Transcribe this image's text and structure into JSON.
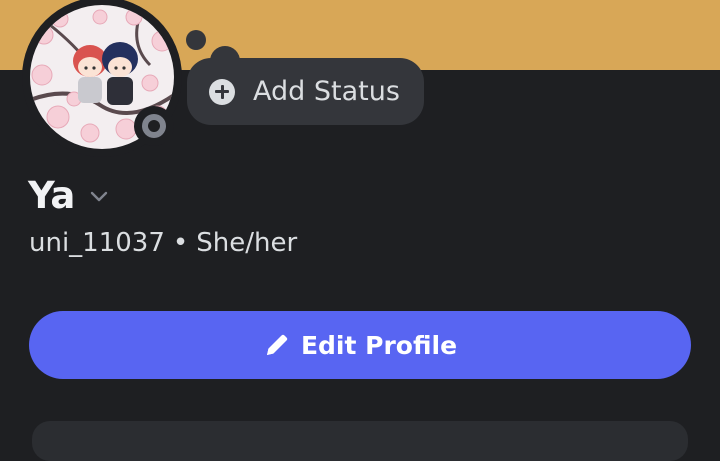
{
  "colors": {
    "banner": "#d8a757",
    "background": "#1e1f22",
    "accent_button": "#5865f2",
    "status_bubble": "#34363b",
    "presence_offline": "#80848e"
  },
  "profile": {
    "avatar_icon": "avatar-image",
    "display_name": "Ya",
    "username": "uni_11037",
    "separator": "•",
    "pronouns": "She/her",
    "presence": "offline"
  },
  "status": {
    "icon": "plus-circle-icon",
    "label": "Add Status"
  },
  "actions": {
    "edit_icon": "pencil-icon",
    "edit_label": "Edit Profile"
  }
}
